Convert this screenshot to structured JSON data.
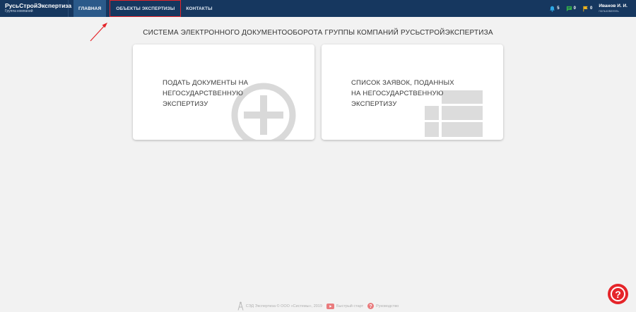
{
  "brand": {
    "title": "РусьСтройЭкспертиза",
    "subtitle": "Группа компаний"
  },
  "nav": {
    "items": [
      {
        "label": "ГЛАВНАЯ",
        "active": true
      },
      {
        "label": "ОБЪЕКТЫ ЭКСПЕРТИЗЫ",
        "highlighted": true
      },
      {
        "label": "КОНТАКТЫ"
      }
    ]
  },
  "counters": {
    "notifications": "5",
    "messages": "0",
    "flags": "0"
  },
  "user": {
    "name": "Иванов И. И.",
    "role": "пользователь"
  },
  "page_title": "СИСТЕМА ЭЛЕКТРОННОГО ДОКУМЕНТООБОРОТА ГРУППЫ КОМПАНИЙ РУСЬСТРОЙЭКСПЕРТИЗА",
  "cards": [
    {
      "label": "ПОДАТЬ ДОКУМЕНТЫ НА НЕГОСУДАРСТВЕННУЮ ЭКСПЕРТИЗУ",
      "icon": "plus-circle-icon"
    },
    {
      "label": "СПИСОК ЗАЯВОК, ПОДАННЫХ НА НЕГОСУДАРСТВЕННУЮ ЭКСПЕРТИЗУ",
      "icon": "list-icon"
    }
  ],
  "footer": {
    "copyright": "СЭД Экспертиза  © ООО «Системы», 2019",
    "quick_start": "Быстрый старт",
    "manual": "Руководство"
  },
  "help": {
    "symbol": "?"
  },
  "colors": {
    "topbar": "#16375f",
    "active_nav": "#2b5a8a",
    "highlight": "#e5252a",
    "bell": "#2ea8e6",
    "chat": "#35b34a",
    "flag": "#f2b51b"
  }
}
